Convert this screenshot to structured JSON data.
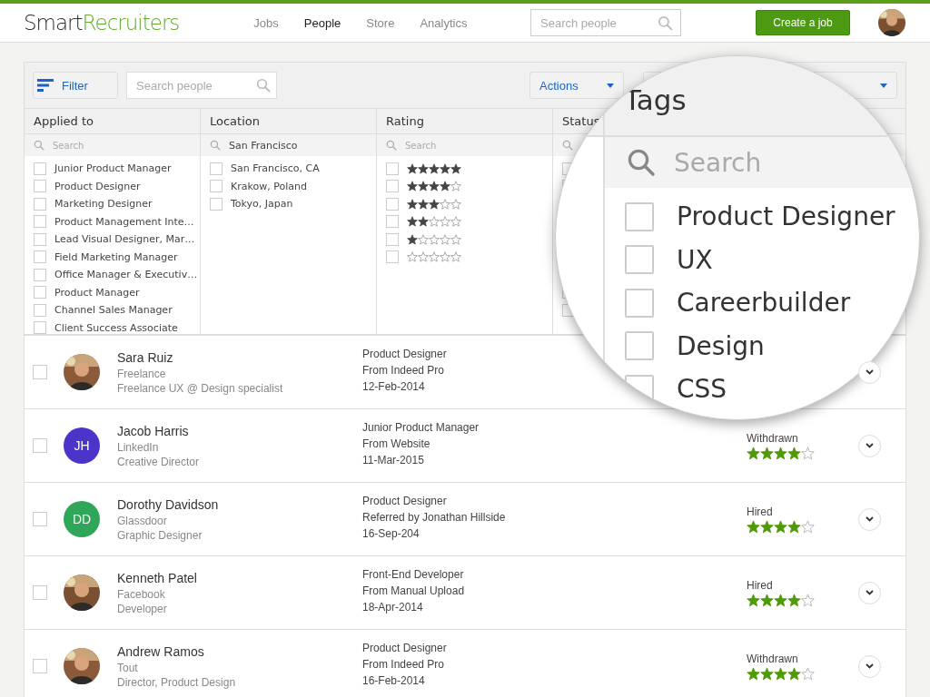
{
  "header": {
    "logo": {
      "part1": "Smart",
      "part2": "Recruiters"
    },
    "nav": [
      {
        "label": "Jobs",
        "selected": false
      },
      {
        "label": "People",
        "selected": true
      },
      {
        "label": "Store",
        "selected": false
      },
      {
        "label": "Analytics",
        "selected": false
      }
    ],
    "search": {
      "placeholder": "Search people"
    },
    "create_button": "Create a job"
  },
  "toolbar": {
    "filter_button": "Filter",
    "search": {
      "placeholder": "Search people"
    },
    "actions_button": "Actions"
  },
  "filter_columns": [
    {
      "title": "Applied to",
      "search": {
        "placeholder": "Search"
      },
      "items": [
        {
          "kind": "text",
          "label": "Junior Product Manager",
          "checked": false
        },
        {
          "kind": "text",
          "label": "Product Designer",
          "checked": false
        },
        {
          "kind": "text",
          "label": "Marketing Designer",
          "checked": false
        },
        {
          "kind": "text",
          "label": "Product Management Inte…",
          "checked": false
        },
        {
          "kind": "text",
          "label": "Lead Visual Designer, Mar…",
          "checked": false
        },
        {
          "kind": "text",
          "label": "Field Marketing Manager",
          "checked": false
        },
        {
          "kind": "text",
          "label": "Office Manager & Executiv…",
          "checked": false
        },
        {
          "kind": "text",
          "label": "Product Manager",
          "checked": false
        },
        {
          "kind": "text",
          "label": "Channel Sales Manager",
          "checked": false
        },
        {
          "kind": "text",
          "label": "Client Success Associate",
          "checked": false
        }
      ]
    },
    {
      "title": "Location",
      "search": {
        "value": "San Francisco"
      },
      "items": [
        {
          "kind": "text",
          "label": "San Francisco, CA",
          "checked": false
        },
        {
          "kind": "text",
          "label": "Krakow, Poland",
          "checked": false
        },
        {
          "kind": "text",
          "label": "Tokyo, Japan",
          "checked": false
        }
      ]
    },
    {
      "title": "Rating",
      "search": {
        "placeholder": "Search"
      },
      "items": [
        {
          "kind": "stars",
          "stars": 5,
          "checked": false
        },
        {
          "kind": "stars",
          "stars": 4,
          "checked": false
        },
        {
          "kind": "stars",
          "stars": 3,
          "checked": false
        },
        {
          "kind": "stars",
          "stars": 2,
          "checked": false
        },
        {
          "kind": "stars",
          "stars": 1,
          "checked": false
        },
        {
          "kind": "stars",
          "stars": 0,
          "checked": false
        }
      ]
    },
    {
      "title": "Status",
      "items": [
        {
          "kind": "blank",
          "checked": false
        },
        {
          "kind": "blank",
          "checked": false
        },
        {
          "kind": "blank",
          "checked": false
        },
        {
          "kind": "blank",
          "checked": false
        }
      ]
    }
  ],
  "magnifier": {
    "title": "Tags",
    "search": {
      "placeholder": "Search"
    },
    "items": [
      {
        "label": "Product Designer",
        "checked": false
      },
      {
        "label": "UX",
        "checked": false
      },
      {
        "label": "Careerbuilder",
        "checked": false
      },
      {
        "label": "Design",
        "checked": false
      },
      {
        "label": "CSS",
        "checked": false
      }
    ]
  },
  "candidates": [
    {
      "checked": false,
      "name": "Sara Ruiz",
      "source": "Freelance",
      "title": "Freelance UX @ Design specialist",
      "job": "Product Designer",
      "origin": "From Indeed Pro",
      "date": "12-Feb-2014"
    },
    {
      "checked": false,
      "avatar": {
        "kind": "initials",
        "initials": "JH",
        "color": "#4b34c9"
      },
      "name": "Jacob Harris",
      "source": "LinkedIn",
      "title": "Creative Director",
      "job": "Junior Product Manager",
      "origin": "From Website",
      "date": "11-Mar-2015",
      "status": "Withdrawn",
      "stars": 4
    },
    {
      "checked": false,
      "avatar": {
        "kind": "initials",
        "initials": "DD",
        "color": "#2fa65a"
      },
      "name": "Dorothy Davidson",
      "source": "Glassdoor",
      "title": "Graphic Designer",
      "job": "Product Designer",
      "origin": "Referred by Jonathan Hillside",
      "date": "16-Sep-204",
      "status": "Hired",
      "stars": 4
    },
    {
      "checked": false,
      "name": "Kenneth Patel",
      "source": "Facebook",
      "title": "Developer",
      "job": "Front-End Developer",
      "origin": "From Manual Upload",
      "date": "18-Apr-2014",
      "status": "Hired",
      "stars": 4
    },
    {
      "checked": false,
      "name": "Andrew Ramos",
      "source": "Tout",
      "title": "Director, Product Design",
      "job": "Product Designer",
      "origin": "From Indeed Pro",
      "date": "16-Feb-2014",
      "status": "Withdrawn",
      "stars": 4
    }
  ]
}
